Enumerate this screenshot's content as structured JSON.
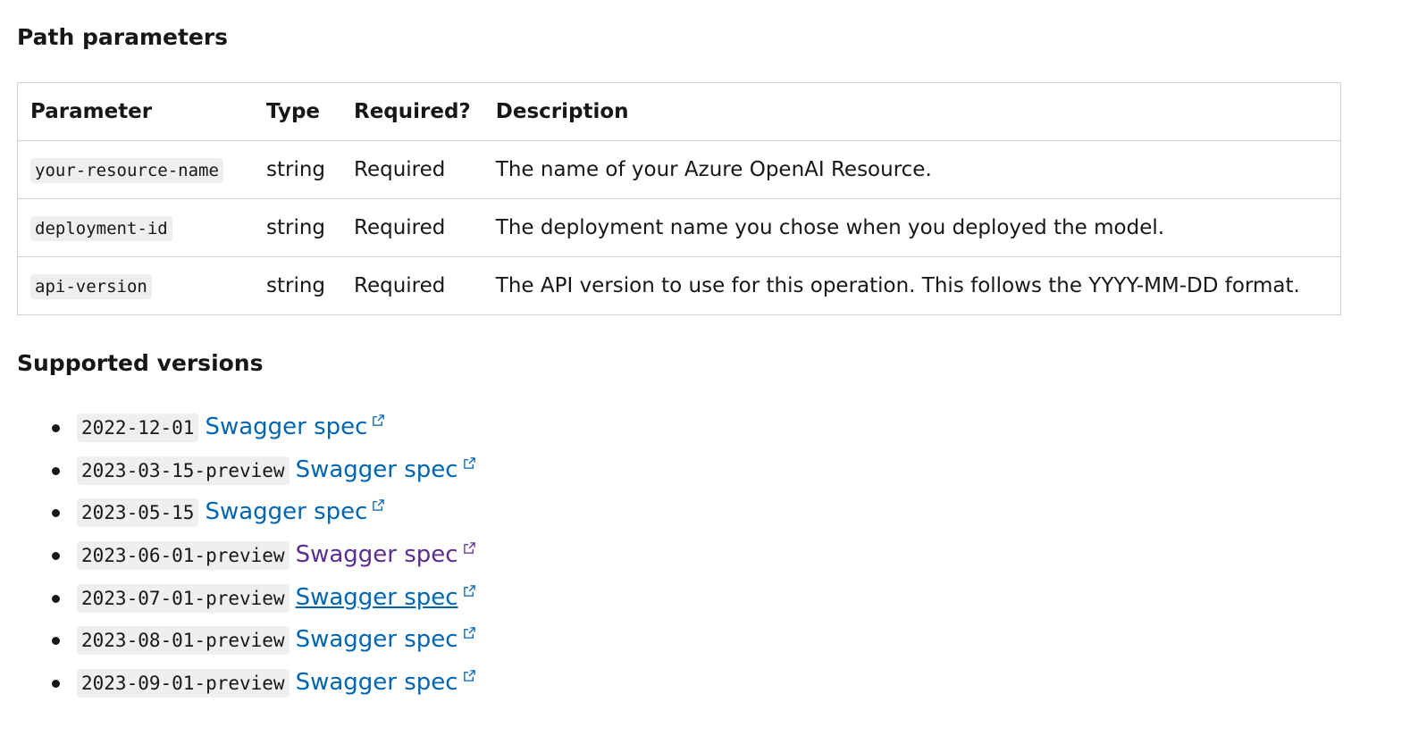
{
  "headings": {
    "path_parameters": "Path parameters",
    "supported_versions": "Supported versions"
  },
  "table": {
    "headers": [
      "Parameter",
      "Type",
      "Required?",
      "Description"
    ],
    "rows": [
      {
        "parameter": "your-resource-name",
        "type": "string",
        "required": "Required",
        "description": "The name of your Azure OpenAI Resource."
      },
      {
        "parameter": "deployment-id",
        "type": "string",
        "required": "Required",
        "description": "The deployment name you chose when you deployed the model."
      },
      {
        "parameter": "api-version",
        "type": "string",
        "required": "Required",
        "description": "The API version to use for this operation. This follows the YYYY-MM-DD format."
      }
    ]
  },
  "versions": [
    {
      "version": "2022-12-01",
      "link": "Swagger spec",
      "state": "default"
    },
    {
      "version": "2023-03-15-preview",
      "link": "Swagger spec",
      "state": "default"
    },
    {
      "version": "2023-05-15",
      "link": "Swagger spec",
      "state": "default"
    },
    {
      "version": "2023-06-01-preview",
      "link": "Swagger spec",
      "state": "visited"
    },
    {
      "version": "2023-07-01-preview",
      "link": "Swagger spec",
      "state": "hover"
    },
    {
      "version": "2023-08-01-preview",
      "link": "Swagger spec",
      "state": "default"
    },
    {
      "version": "2023-09-01-preview",
      "link": "Swagger spec",
      "state": "default"
    }
  ],
  "icons": {
    "external_link": "external-link-icon"
  },
  "colors": {
    "link": "#0065b3",
    "link_visited": "#5c2e91",
    "text": "#171717",
    "code_bg": "#efefef",
    "border": "#d1d1d1"
  }
}
